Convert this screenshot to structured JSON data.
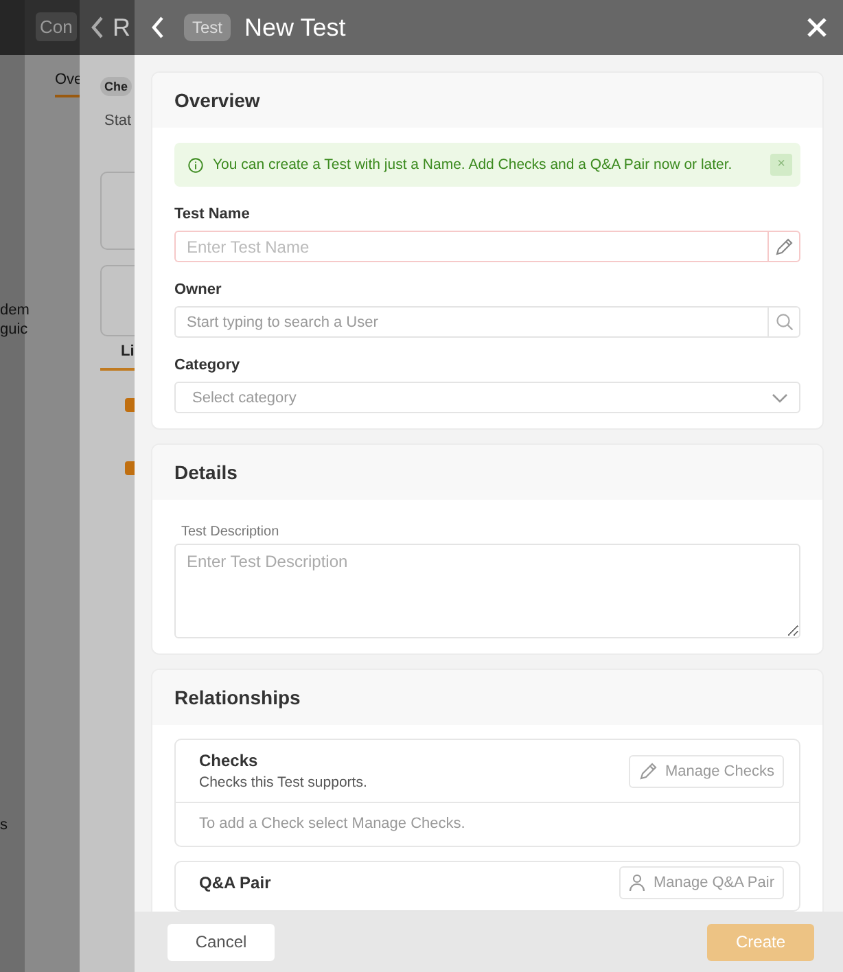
{
  "backdrop": {
    "base": {
      "header_button": "Con",
      "texts": [
        "dem",
        "guic",
        "s"
      ]
    },
    "middle": {
      "tab": "Ove"
    },
    "front": {
      "title": "R",
      "badge": "Che",
      "status": "Stat",
      "tab": "Li",
      "checkboxes": [
        {
          "checked": true
        },
        {
          "checked": true
        }
      ]
    }
  },
  "drawer": {
    "badge": "Test",
    "title": "New Test",
    "overview": {
      "title": "Overview",
      "alert": {
        "text": "You can create a Test with just a Name. Add Checks and a Q&A Pair now or later.",
        "close": "×"
      },
      "fields": [
        {
          "kind": "text",
          "label": "Test Name",
          "placeholder": "Enter Test Name",
          "invalid": true
        },
        {
          "kind": "search",
          "label": "Owner",
          "placeholder": "Start typing to search a User",
          "invalid": false
        },
        {
          "kind": "select",
          "label": "Category",
          "placeholder": "Select category",
          "invalid": false
        }
      ]
    },
    "details": {
      "title": "Details",
      "label": "Test Description",
      "placeholder": "Enter Test Description"
    },
    "relationships": {
      "title": "Relationships",
      "groups": [
        {
          "title": "Checks",
          "subtitle": "Checks this Test supports.",
          "button": "Manage Checks",
          "empty": "To add a Check select Manage Checks."
        },
        {
          "title": "Q&A Pair",
          "button": "Manage Q&A Pair"
        }
      ]
    },
    "footer": {
      "cancel": "Cancel",
      "create": {
        "label": "Create",
        "disabled": true
      }
    }
  }
}
